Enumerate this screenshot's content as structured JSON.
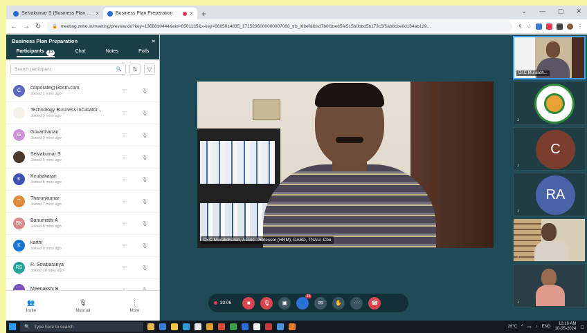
{
  "browser": {
    "tabs": [
      {
        "label": "Selvakumar S (Business Plan Pr...",
        "favicon_color": "#2b6cd4"
      },
      {
        "label": "Business Plan Preparation",
        "favicon_color": "#2b6cd4"
      }
    ],
    "new_tab": "+",
    "window_controls": [
      "⌄",
      "—",
      "▢",
      "✕"
    ],
    "nav": {
      "back": "←",
      "forward": "→",
      "reload": "↻"
    },
    "url": "meeting.zoho.in/meeting/preview.do?key=1368810444&eid=6501135&x-key=6685014835_1715296000000007063_trb_l88ef&lbsd7b0f1be85fe515b0bbd5b173c5f5ab8cbe0d184ab139..."
  },
  "sidebar": {
    "title": "Business Plan Preparation",
    "close": "×",
    "tabs": [
      {
        "label": "Participants",
        "count": "15",
        "active": true
      },
      {
        "label": "Chat",
        "active": false
      },
      {
        "label": "Notes",
        "active": false
      },
      {
        "label": "Polls",
        "active": false
      }
    ],
    "search_placeholder": "Search participant",
    "participants": [
      {
        "initial": "C",
        "name": "corporate@l3ostn.com",
        "joined": "Joined 1 mins ago",
        "color": "#5c6bc0"
      },
      {
        "initial": "",
        "name": "Technology Business Incubator...",
        "joined": "Joined 3 mins ago",
        "color": "#f3f1e8"
      },
      {
        "initial": "G",
        "name": "Govarthanan",
        "joined": "Joined 3 mins ago",
        "color": "#ce93d8"
      },
      {
        "initial": "",
        "name": "Selvakumar S",
        "joined": "Joined 5 mins ago",
        "color": "#4a3a2e"
      },
      {
        "initial": "K",
        "name": "Kirubakaran",
        "joined": "Joined 6 mins ago",
        "color": "#3f51b5"
      },
      {
        "initial": "T",
        "name": "Tharunkumar",
        "joined": "Joined 7 mins ago",
        "color": "#e08a3a"
      },
      {
        "initial": "BK",
        "name": "Banumathi A",
        "joined": "Joined 8 mins ago",
        "color": "#d98a8a"
      },
      {
        "initial": "K",
        "name": "karthi",
        "joined": "Joined 9 mins ago",
        "color": "#1976d2"
      },
      {
        "initial": "RS",
        "name": "R. Sowbaranya",
        "joined": "Joined 10 mins ago",
        "color": "#26a69a"
      },
      {
        "initial": "",
        "name": "Meenakshi B",
        "joined": "",
        "color": "#7e57c2"
      }
    ],
    "footer": [
      {
        "icon": "👥",
        "label": "Invite"
      },
      {
        "icon": "🎙",
        "label": "Mute all"
      },
      {
        "icon": "⋮",
        "label": "More"
      }
    ]
  },
  "video": {
    "caption": "Dr.C.Muralidharan, Assoc. Professor (HRM), DABD, TNAU, Cbe"
  },
  "strip": {
    "tiles": [
      {
        "kind": "video",
        "label": "Dr.C.Muralidh..."
      },
      {
        "kind": "logo"
      },
      {
        "kind": "avatar",
        "text": "C",
        "color": "#7a3e2e"
      },
      {
        "kind": "avatar",
        "text": "RA",
        "color": "#4a63a8"
      },
      {
        "kind": "video"
      },
      {
        "kind": "video"
      }
    ]
  },
  "toolbar": {
    "recording_time": "33:06",
    "participant_badge": "15",
    "buttons": [
      {
        "name": "video-button",
        "icon": "■",
        "color": "#d64550"
      },
      {
        "name": "mic-button",
        "icon": "🎙",
        "color": "#d64550"
      },
      {
        "name": "screenshare-button",
        "icon": "▣",
        "color": "#3a5560"
      },
      {
        "name": "participants-button",
        "icon": "👤",
        "color": "#2e6fd8"
      },
      {
        "name": "chat-button",
        "icon": "✉",
        "color": "#3a5560"
      },
      {
        "name": "raise-hand-button",
        "icon": "✋",
        "color": "#3a5560"
      },
      {
        "name": "more-button",
        "icon": "⋯",
        "color": "#3a5560"
      },
      {
        "name": "end-call-button",
        "icon": "☎",
        "color": "#d64550"
      }
    ]
  },
  "taskbar": {
    "search_placeholder": "Type here to search",
    "app_colors": [
      "#e8b84a",
      "#3a7bd5",
      "#f4c542",
      "#2e9bd6",
      "#e8e8e8",
      "#e0a030",
      "#d64a3a",
      "#3a9d4a",
      "#2b6cd4",
      "#f2f2f2",
      "#c43b3b",
      "#4a90d9",
      "#e57a2e"
    ],
    "weather": "26°C",
    "lang": "ENG",
    "time": "10:16 AM",
    "date": "10-05-2024"
  }
}
